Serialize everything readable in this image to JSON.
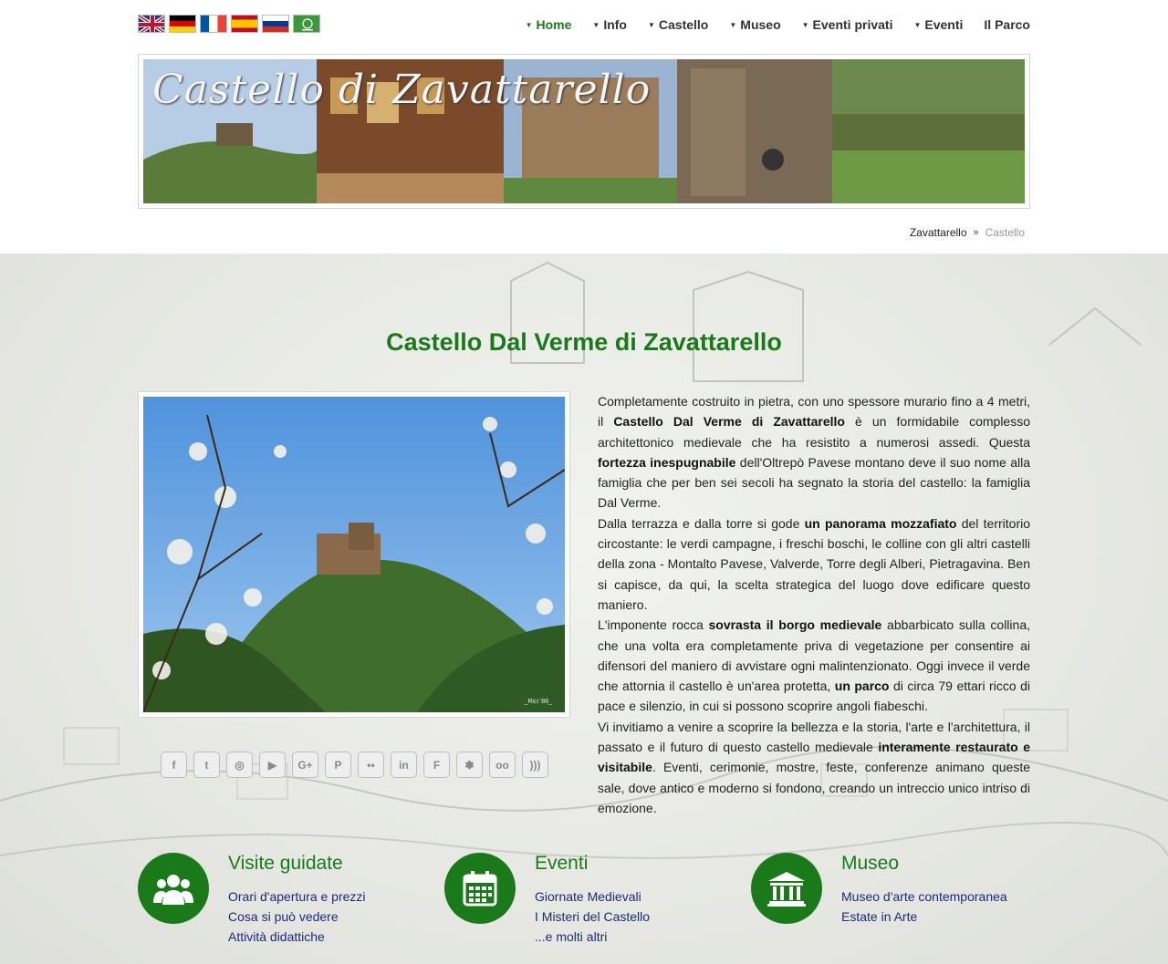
{
  "languages": [
    {
      "name": "English",
      "icon": "uk-flag-icon"
    },
    {
      "name": "Deutsch",
      "icon": "germany-flag-icon"
    },
    {
      "name": "Français",
      "icon": "france-flag-icon"
    },
    {
      "name": "Español",
      "icon": "spain-flag-icon"
    },
    {
      "name": "Русский",
      "icon": "russia-flag-icon"
    },
    {
      "name": "العربية",
      "icon": "saudi-flag-icon"
    }
  ],
  "nav": {
    "items": [
      {
        "label": "Home",
        "active": true,
        "dropdown": true
      },
      {
        "label": "Info",
        "active": false,
        "dropdown": true
      },
      {
        "label": "Castello",
        "active": false,
        "dropdown": true
      },
      {
        "label": "Museo",
        "active": false,
        "dropdown": true
      },
      {
        "label": "Eventi privati",
        "active": false,
        "dropdown": true
      },
      {
        "label": "Eventi",
        "active": false,
        "dropdown": true
      },
      {
        "label": "Il Parco",
        "active": false,
        "dropdown": false
      }
    ]
  },
  "banner": {
    "title": "Castello di Zavattarello"
  },
  "breadcrumb": {
    "home": "Zavattarello",
    "separator": "»",
    "current": "Castello"
  },
  "main": {
    "title": "Castello Dal Verme di Zavattarello",
    "photo_caption": "_Rici '86_",
    "paragraphs": [
      [
        {
          "t": "Completamente costruito in pietra, con uno spessore murario fino a 4 metri, il ",
          "b": false
        },
        {
          "t": "Castello Dal Verme di Zavattarello",
          "b": true
        },
        {
          "t": " è un formidabile complesso architettonico medievale che ha resistito a numerosi assedi. Questa ",
          "b": false
        },
        {
          "t": "fortezza inespugnabile",
          "b": true
        },
        {
          "t": " dell'Oltrepò Pavese montano deve il suo nome alla famiglia che per ben sei secoli ha segnato la storia del castello: la famiglia Dal Verme.",
          "b": false
        }
      ],
      [
        {
          "t": "Dalla terrazza e dalla torre si gode ",
          "b": false
        },
        {
          "t": "un panorama mozzafiato",
          "b": true
        },
        {
          "t": " del territorio circostante: le verdi campagne, i freschi boschi, le colline con gli altri castelli della zona - Montalto Pavese, Valverde, Torre degli Alberi, Pietragavina. Ben si capisce, da qui, la scelta strategica del luogo dove edificare questo maniero.",
          "b": false
        }
      ],
      [
        {
          "t": "L'imponente rocca ",
          "b": false
        },
        {
          "t": "sovrasta il borgo medievale",
          "b": true
        },
        {
          "t": " abbarbicato sulla collina, che una volta era completamente priva di vegetazione per consentire ai difensori del maniero di avvistare ogni malintenzionato. Oggi invece il verde che attornia il castello è un'area protetta, ",
          "b": false
        },
        {
          "t": "un parco",
          "b": true
        },
        {
          "t": " di circa 79 ettari ricco di pace e silenzio, in cui si possono scoprire angoli fiabeschi.",
          "b": false
        }
      ],
      [
        {
          "t": "Vi invitiamo a venire a scoprire la bellezza e la storia, l'arte e l'architettura, il passato e il futuro di questo castello medievale ",
          "b": false
        },
        {
          "t": "interamente restaurato e visitabile",
          "b": true
        },
        {
          "t": ". Eventi, cerimonie, mostre, feste, conferenze animano queste sale, dove antico e moderno si fondono, creando un intreccio unico intriso di emozione.",
          "b": false
        }
      ]
    ]
  },
  "social": [
    {
      "name": "facebook-icon",
      "glyph": "f"
    },
    {
      "name": "twitter-icon",
      "glyph": "t"
    },
    {
      "name": "instagram-icon",
      "glyph": "◎"
    },
    {
      "name": "youtube-icon",
      "glyph": "▶"
    },
    {
      "name": "google-plus-icon",
      "glyph": "G+"
    },
    {
      "name": "pinterest-icon",
      "glyph": "P"
    },
    {
      "name": "flickr-icon",
      "glyph": "••"
    },
    {
      "name": "linkedin-icon",
      "glyph": "in"
    },
    {
      "name": "foursquare-icon",
      "glyph": "F"
    },
    {
      "name": "yelp-icon",
      "glyph": "✽"
    },
    {
      "name": "tripadvisor-icon",
      "glyph": "oo"
    },
    {
      "name": "rss-icon",
      "glyph": ")))"
    }
  ],
  "features": [
    {
      "title": "Visite guidate",
      "icon": "group-icon",
      "links": [
        "Orari d'apertura e prezzi",
        "Cosa si può vedere",
        "Attività didattiche"
      ]
    },
    {
      "title": "Eventi",
      "icon": "calendar-icon",
      "links": [
        "Giornate Medievali",
        "I Misteri del Castello",
        "...e molti altri"
      ]
    },
    {
      "title": "Museo",
      "icon": "museum-icon",
      "links": [
        "Museo d'arte contemporanea",
        "Estate in Arte"
      ]
    }
  ],
  "colors": {
    "brand_green": "#1a7a1a",
    "link_navy": "#1c2a7a"
  }
}
